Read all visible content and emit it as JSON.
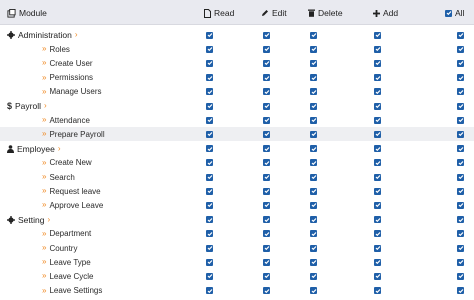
{
  "header": {
    "module": "Module",
    "read": "Read",
    "edit": "Edit",
    "delete": "Delete",
    "add": "Add",
    "all": "All"
  },
  "rows": [
    {
      "label": "Administration",
      "type": "section",
      "icon": "gear-icon"
    },
    {
      "label": "Roles",
      "type": "item"
    },
    {
      "label": "Create User",
      "type": "item"
    },
    {
      "label": "Permissions",
      "type": "item"
    },
    {
      "label": "Manage Users",
      "type": "item"
    },
    {
      "label": "Payroll",
      "type": "section",
      "icon": "dollar-icon"
    },
    {
      "label": "Attendance",
      "type": "item"
    },
    {
      "label": "Prepare Payroll",
      "type": "item",
      "highlight": true
    },
    {
      "label": "Employee",
      "type": "section",
      "icon": "user-icon"
    },
    {
      "label": "Create New",
      "type": "item"
    },
    {
      "label": "Search",
      "type": "item"
    },
    {
      "label": "Request leave",
      "type": "item"
    },
    {
      "label": "Approve Leave",
      "type": "item"
    },
    {
      "label": "Setting",
      "type": "section",
      "icon": "gear-icon"
    },
    {
      "label": "Department",
      "type": "item"
    },
    {
      "label": "Country",
      "type": "item"
    },
    {
      "label": "Leave Type",
      "type": "item"
    },
    {
      "label": "Leave Cycle",
      "type": "item"
    },
    {
      "label": "Leave Settings",
      "type": "item"
    }
  ],
  "colors": {
    "checkbox": "#1f5fa8",
    "chevron": "#f08a24",
    "header_bg": "#e9eaf0"
  }
}
